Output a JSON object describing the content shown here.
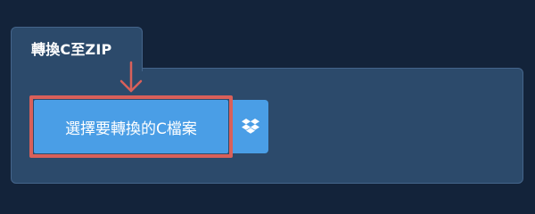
{
  "converter": {
    "tab_title": "轉換C至ZIP",
    "choose_file_label": "選擇要轉換的C檔案",
    "dropbox_icon": "dropbox-icon",
    "arrow_icon": "arrow-down-icon"
  },
  "colors": {
    "background": "#13233a",
    "panel": "#2c4a6b",
    "button": "#4a9ee6",
    "highlight": "#d9605a"
  }
}
